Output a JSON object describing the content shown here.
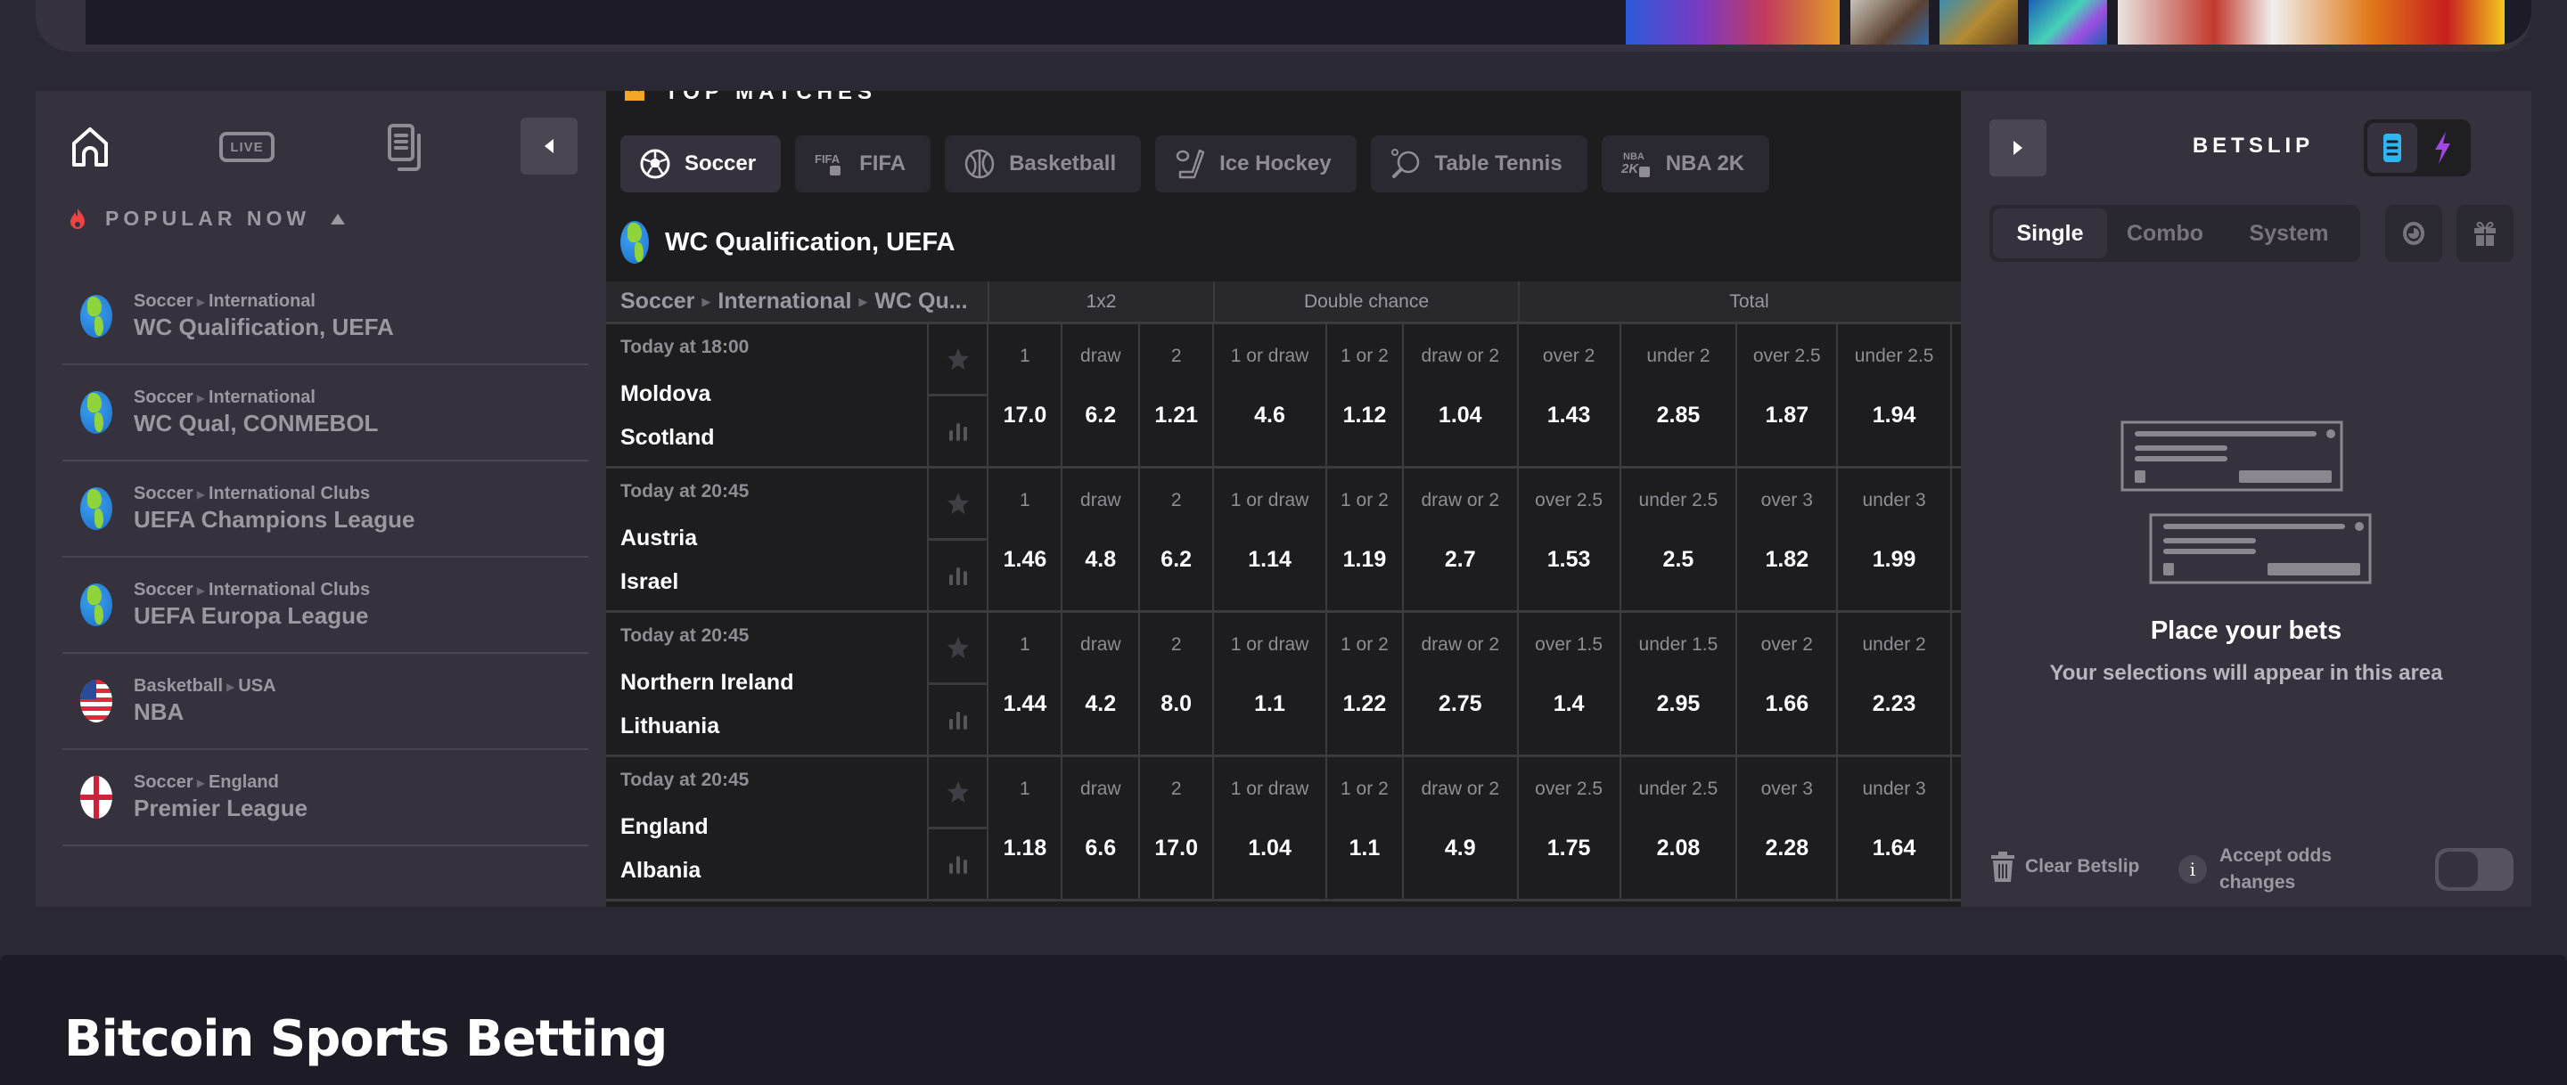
{
  "sidebar": {
    "nav": {
      "home_icon": "home-icon",
      "live_label": "LIVE",
      "bets_icon": "my-bets-icon",
      "collapse_icon": "chevron-left-icon"
    },
    "popular_title": "POPULAR NOW",
    "popular_icon": "fire-icon",
    "popular_items": [
      {
        "sport": "Soccer",
        "region": "International",
        "name": "WC Qualification, UEFA",
        "flag": "globe"
      },
      {
        "sport": "Soccer",
        "region": "International",
        "name": "WC Qual, CONMEBOL",
        "flag": "globe"
      },
      {
        "sport": "Soccer",
        "region": "International Clubs",
        "name": "UEFA Champions League",
        "flag": "globe"
      },
      {
        "sport": "Soccer",
        "region": "International Clubs",
        "name": "UEFA Europa League",
        "flag": "globe"
      },
      {
        "sport": "Basketball",
        "region": "USA",
        "name": "NBA",
        "flag": "usa"
      },
      {
        "sport": "Soccer",
        "region": "England",
        "name": "Premier League",
        "flag": "england"
      }
    ]
  },
  "center": {
    "top_matches_title": "TOP MATCHES",
    "sport_tabs": [
      {
        "label": "Soccer",
        "icon": "soccer-ball-icon",
        "active": true
      },
      {
        "label": "FIFA",
        "icon": "fifa-icon",
        "active": false
      },
      {
        "label": "Basketball",
        "icon": "basketball-icon",
        "active": false
      },
      {
        "label": "Ice Hockey",
        "icon": "ice-hockey-icon",
        "active": false
      },
      {
        "label": "Table Tennis",
        "icon": "table-tennis-icon",
        "active": false
      },
      {
        "label": "NBA 2K",
        "icon": "nba2k-icon",
        "active": false
      }
    ],
    "league_title": "WC Qualification, UEFA",
    "table": {
      "breadcrumb": [
        "Soccer",
        "International",
        "WC Qu..."
      ],
      "groups": [
        "1x2",
        "Double chance",
        "Total"
      ],
      "matches": [
        {
          "time": "Today at 18:00",
          "home": "Moldova",
          "away": "Scotland",
          "odds": [
            {
              "label": "1",
              "value": "17.0"
            },
            {
              "label": "draw",
              "value": "6.2"
            },
            {
              "label": "2",
              "value": "1.21"
            },
            {
              "label": "1 or draw",
              "value": "4.6"
            },
            {
              "label": "1 or 2",
              "value": "1.12"
            },
            {
              "label": "draw or 2",
              "value": "1.04"
            },
            {
              "label": "over 2",
              "value": "1.43"
            },
            {
              "label": "under 2",
              "value": "2.85"
            },
            {
              "label": "over 2.5",
              "value": "1.87"
            },
            {
              "label": "under 2.5",
              "value": "1.94"
            }
          ]
        },
        {
          "time": "Today at 20:45",
          "home": "Austria",
          "away": "Israel",
          "odds": [
            {
              "label": "1",
              "value": "1.46"
            },
            {
              "label": "draw",
              "value": "4.8"
            },
            {
              "label": "2",
              "value": "6.2"
            },
            {
              "label": "1 or draw",
              "value": "1.14"
            },
            {
              "label": "1 or 2",
              "value": "1.19"
            },
            {
              "label": "draw or 2",
              "value": "2.7"
            },
            {
              "label": "over 2.5",
              "value": "1.53"
            },
            {
              "label": "under 2.5",
              "value": "2.5"
            },
            {
              "label": "over 3",
              "value": "1.82"
            },
            {
              "label": "under 3",
              "value": "1.99"
            }
          ]
        },
        {
          "time": "Today at 20:45",
          "home": "Northern Ireland",
          "away": "Lithuania",
          "odds": [
            {
              "label": "1",
              "value": "1.44"
            },
            {
              "label": "draw",
              "value": "4.2"
            },
            {
              "label": "2",
              "value": "8.0"
            },
            {
              "label": "1 or draw",
              "value": "1.1"
            },
            {
              "label": "1 or 2",
              "value": "1.22"
            },
            {
              "label": "draw or 2",
              "value": "2.75"
            },
            {
              "label": "over 1.5",
              "value": "1.4"
            },
            {
              "label": "under 1.5",
              "value": "2.95"
            },
            {
              "label": "over 2",
              "value": "1.66"
            },
            {
              "label": "under 2",
              "value": "2.23"
            }
          ]
        },
        {
          "time": "Today at 20:45",
          "home": "England",
          "away": "Albania",
          "odds": [
            {
              "label": "1",
              "value": "1.18"
            },
            {
              "label": "draw",
              "value": "6.6"
            },
            {
              "label": "2",
              "value": "17.0"
            },
            {
              "label": "1 or draw",
              "value": "1.04"
            },
            {
              "label": "1 or 2",
              "value": "1.1"
            },
            {
              "label": "draw or 2",
              "value": "4.9"
            },
            {
              "label": "over 2.5",
              "value": "1.75"
            },
            {
              "label": "under 2.5",
              "value": "2.08"
            },
            {
              "label": "over 3",
              "value": "2.28"
            },
            {
              "label": "under 3",
              "value": "1.64"
            }
          ]
        }
      ]
    }
  },
  "betslip": {
    "title": "BETSLIP",
    "collapse_icon": "chevron-right-icon",
    "modes": [
      {
        "icon": "betslip-list-icon",
        "color": "#2fb4f4",
        "active": true
      },
      {
        "icon": "lightning-icon",
        "color": "#a346e8",
        "active": false
      }
    ],
    "types": [
      "Single",
      "Combo",
      "System"
    ],
    "active_type": "Single",
    "empty_title": "Place your bets",
    "empty_subtitle": "Your selections will appear in this area",
    "clear_label": "Clear Betslip",
    "accept_odds_label": "Accept odds changes",
    "accept_odds_enabled": false
  },
  "bottom": {
    "title": "Bitcoin Sports Betting"
  },
  "colors": {
    "fire": "#ef4343",
    "crown": "#f5a623",
    "betslip_mode_active": "#2fb4f4",
    "lightning": "#a346e8"
  }
}
